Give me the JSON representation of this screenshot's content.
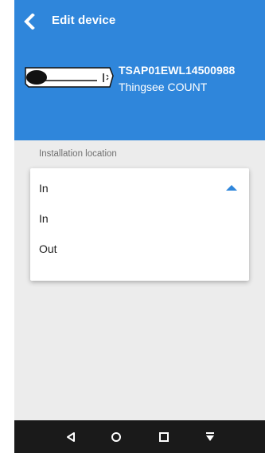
{
  "header": {
    "title": "Edit device",
    "device_id": "TSAP01EWL14500988",
    "device_model": "Thingsee COUNT"
  },
  "form": {
    "location_label": "Installation location",
    "location_selected": "In",
    "location_options": [
      "In",
      "Out"
    ]
  },
  "icons": {
    "back": "chevron-left-icon",
    "dropdown": "triangle-up-icon",
    "nav_back": "triangle-left-icon",
    "nav_home": "circle-icon",
    "nav_recents": "square-icon",
    "nav_extra": "download-icon"
  },
  "colors": {
    "accent": "#2f86db",
    "background": "#ececec",
    "navbar": "#1a1a1a"
  }
}
